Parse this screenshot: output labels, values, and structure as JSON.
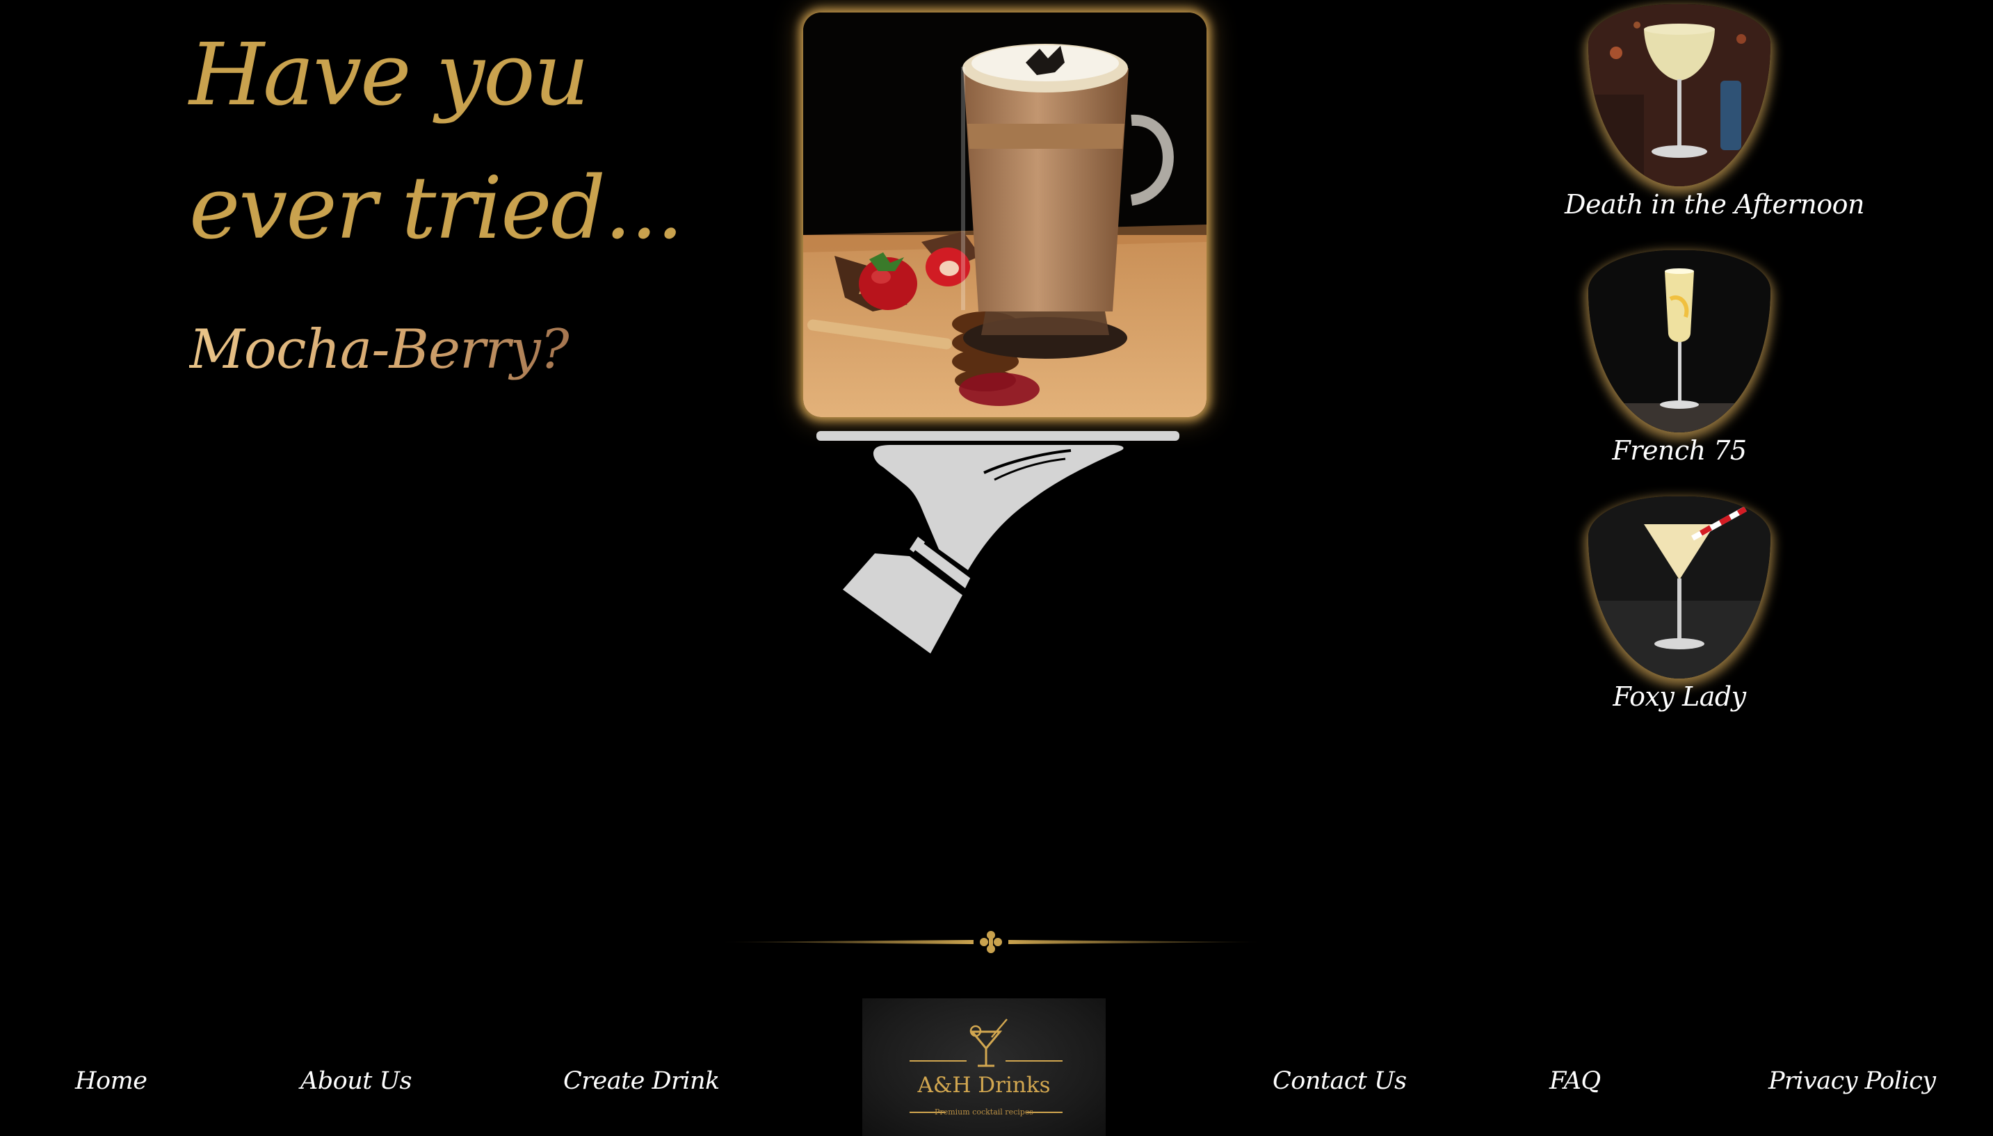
{
  "hero": {
    "headline_line1": "Have you",
    "headline_line2": "ever tried...",
    "drink_question": "Mocha-Berry?"
  },
  "menu": {
    "items": [
      {
        "name": "Death in the Afternoon",
        "icon": "coupe-glass-photo"
      },
      {
        "name": "French 75",
        "icon": "champagne-flute-photo"
      },
      {
        "name": "Foxy Lady",
        "icon": "martini-glass-photo"
      }
    ]
  },
  "nav": {
    "links": [
      "Home",
      "About Us",
      "Create Drink",
      "Contact Us",
      "FAQ",
      "Privacy Policy"
    ]
  },
  "logo": {
    "title": "A&H Drinks",
    "tagline": "Premium cocktail recipes"
  },
  "colors": {
    "background": "#000000",
    "gold": "#c9a24e",
    "nav_text": "#ffffff",
    "tray": "#d4d4d4"
  }
}
